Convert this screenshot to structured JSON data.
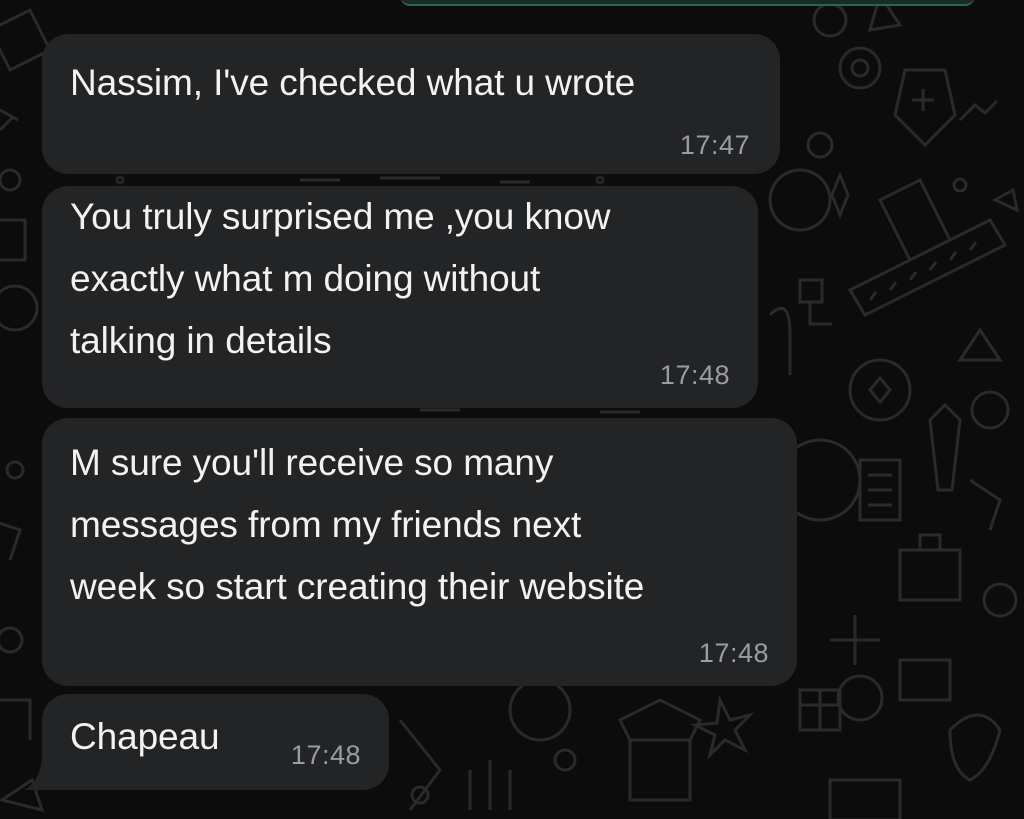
{
  "messages": [
    {
      "lines": [
        "Nassim, I've checked what u wrote"
      ],
      "time": "17:47"
    },
    {
      "lines": [
        "You truly surprised me ,you know",
        "exactly what m doing without",
        "talking in details"
      ],
      "time": "17:48"
    },
    {
      "lines": [
        "M sure you'll receive so many",
        "messages from my friends next",
        "week so start creating their website"
      ],
      "time": "17:48"
    },
    {
      "lines": [
        "Chapeau"
      ],
      "time": "17:48"
    }
  ],
  "colors": {
    "background": "#0c0c0c",
    "bubble": "#232426",
    "text": "#f2f2f2",
    "timestamp": "#9a9c9f",
    "doodle": "#2a2a2a"
  }
}
